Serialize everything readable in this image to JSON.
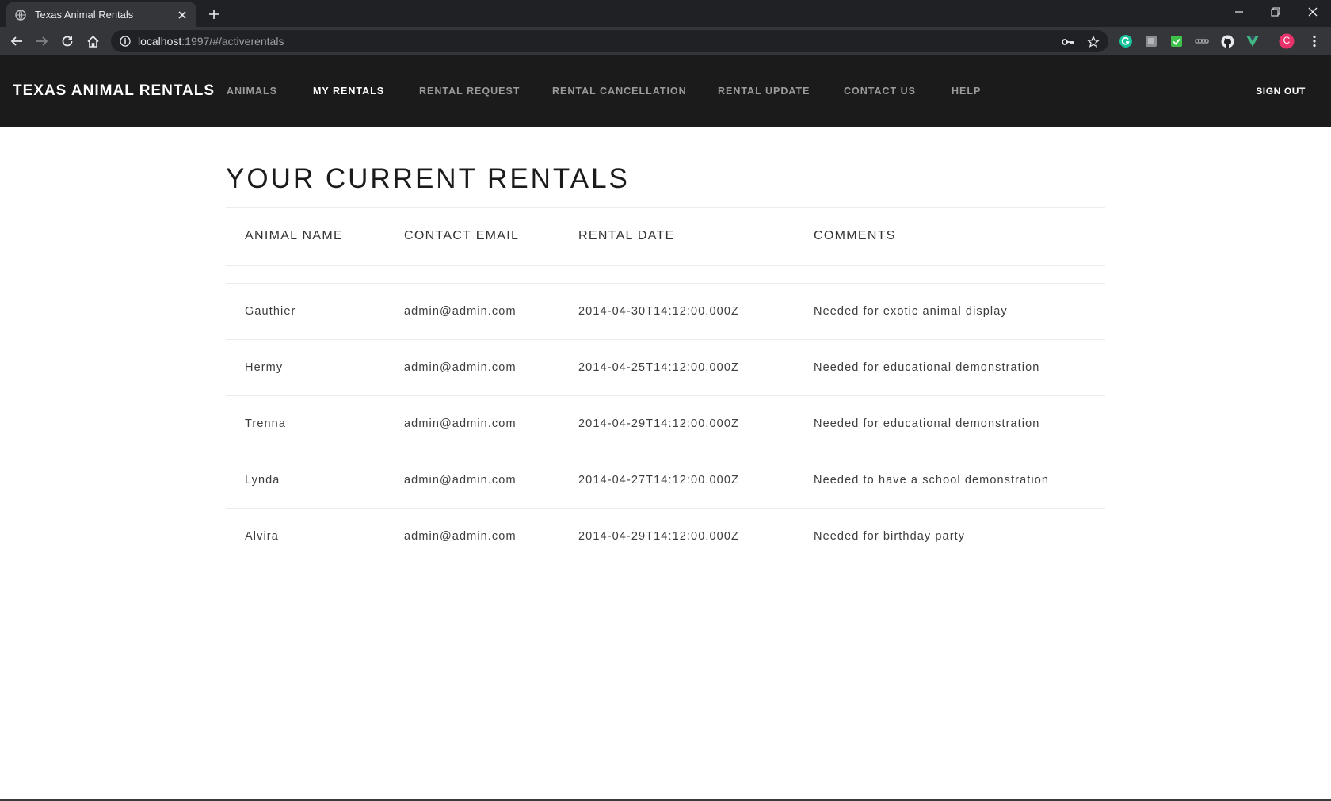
{
  "browser": {
    "tab_title": "Texas Animal Rentals",
    "url_host": "localhost",
    "url_path": ":1997/#/activerentals",
    "profile_initial": "C"
  },
  "site": {
    "brand": "TEXAS ANIMAL RENTALS",
    "nav": [
      {
        "label": "ANIMALS",
        "active": false
      },
      {
        "label": "MY RENTALS",
        "active": true
      },
      {
        "label": "RENTAL REQUEST",
        "active": false
      },
      {
        "label": "RENTAL CANCELLATION",
        "active": false
      },
      {
        "label": "RENTAL UPDATE",
        "active": false
      },
      {
        "label": "CONTACT US",
        "active": false
      },
      {
        "label": "HELP",
        "active": false
      }
    ],
    "sign_out": "SIGN OUT"
  },
  "main": {
    "title": "YOUR CURRENT RENTALS",
    "columns": [
      "ANIMAL NAME",
      "CONTACT EMAIL",
      "RENTAL DATE",
      "COMMENTS"
    ],
    "rows": [
      [
        "Gauthier",
        "admin@admin.com",
        "2014-04-30T14:12:00.000Z",
        "Needed for exotic animal display"
      ],
      [
        "Hermy",
        "admin@admin.com",
        "2014-04-25T14:12:00.000Z",
        "Needed for educational demonstration"
      ],
      [
        "Trenna",
        "admin@admin.com",
        "2014-04-29T14:12:00.000Z",
        "Needed for educational demonstration"
      ],
      [
        "Lynda",
        "admin@admin.com",
        "2014-04-27T14:12:00.000Z",
        "Needed to have a school demonstration"
      ],
      [
        "Alvira",
        "admin@admin.com",
        "2014-04-29T14:12:00.000Z",
        "Needed for birthday party"
      ]
    ]
  },
  "colors": {
    "chrome_dark": "#202124",
    "chrome_toolbar": "#35363a",
    "site_nav_bg": "#1b1b1b",
    "nav_inactive": "#9b9b9b",
    "nav_active": "#ffffff"
  }
}
